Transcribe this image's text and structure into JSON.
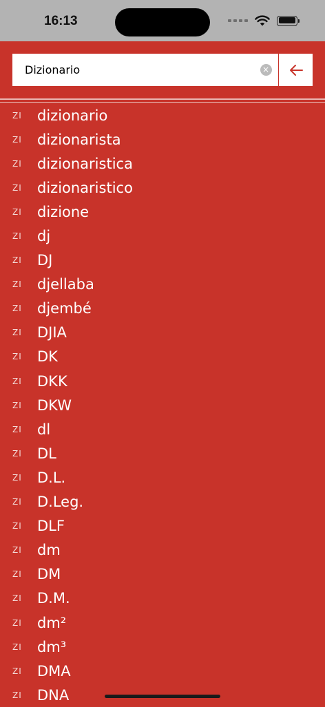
{
  "status": {
    "time": "16:13"
  },
  "search": {
    "value": "Dizionario",
    "clear_symbol": "×"
  },
  "results": [
    {
      "lang": "ZI",
      "word": "dizionario"
    },
    {
      "lang": "ZI",
      "word": "dizionarista"
    },
    {
      "lang": "ZI",
      "word": "dizionaristica"
    },
    {
      "lang": "ZI",
      "word": "dizionaristico"
    },
    {
      "lang": "ZI",
      "word": "dizione"
    },
    {
      "lang": "ZI",
      "word": "dj"
    },
    {
      "lang": "ZI",
      "word": "DJ"
    },
    {
      "lang": "ZI",
      "word": "djellaba"
    },
    {
      "lang": "ZI",
      "word": "djembé"
    },
    {
      "lang": "ZI",
      "word": "DJIA"
    },
    {
      "lang": "ZI",
      "word": "DK"
    },
    {
      "lang": "ZI",
      "word": "DKK"
    },
    {
      "lang": "ZI",
      "word": "DKW"
    },
    {
      "lang": "ZI",
      "word": "dl"
    },
    {
      "lang": "ZI",
      "word": "DL"
    },
    {
      "lang": "ZI",
      "word": "D.L."
    },
    {
      "lang": "ZI",
      "word": "D.Leg."
    },
    {
      "lang": "ZI",
      "word": "DLF"
    },
    {
      "lang": "ZI",
      "word": "dm"
    },
    {
      "lang": "ZI",
      "word": "DM"
    },
    {
      "lang": "ZI",
      "word": "D.M."
    },
    {
      "lang": "ZI",
      "word": "dm²"
    },
    {
      "lang": "ZI",
      "word": "dm³"
    },
    {
      "lang": "ZI",
      "word": "DMA"
    },
    {
      "lang": "ZI",
      "word": "DNA"
    }
  ],
  "colors": {
    "accent": "#c8332a",
    "status_bar": "#b3b3b3"
  },
  "icons": {
    "back": "arrow-left-icon",
    "clear": "clear-circle-icon"
  }
}
